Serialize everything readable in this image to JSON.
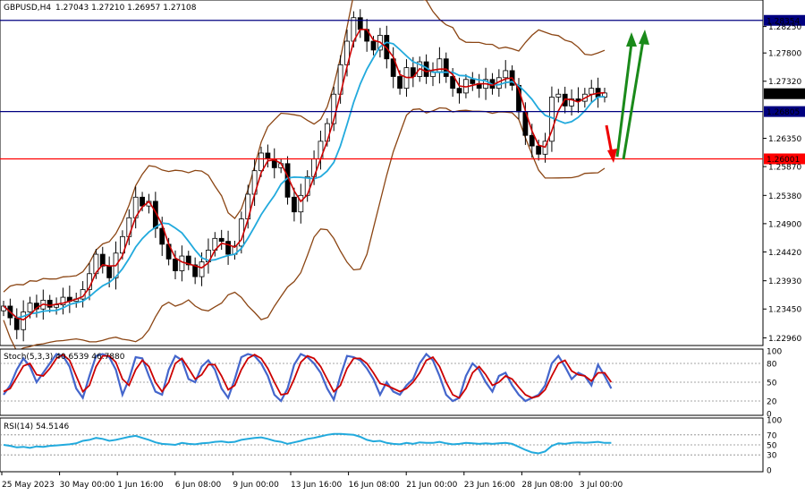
{
  "chart_data": {
    "type": "candlestick",
    "symbol_info": "GBPUSD,H4",
    "ohlc_info": "1.27043 1.27210 1.26957 1.27108",
    "price_ticks": [
      "1.28250",
      "1.27800",
      "1.27320",
      "1.26350",
      "1.25870",
      "1.25380",
      "1.24900",
      "1.24420",
      "1.23930",
      "1.23450",
      "1.22960"
    ],
    "price_range": [
      1.2283,
      1.287
    ],
    "x_labels": [
      "25 May 2023",
      "30 May 00:00",
      "1 Jun 16:00",
      "6 Jun 08:00",
      "9 Jun 00:00",
      "13 Jun 16:00",
      "16 Jun 08:00",
      "21 Jun 00:00",
      "23 Jun 16:00",
      "28 Jun 08:00",
      "3 Jul 00:00"
    ],
    "levels": [
      {
        "price": 1.28354,
        "label": "1.28354",
        "color": "#000080"
      },
      {
        "price": 1.26805,
        "label": "1.26805",
        "color": "#000080"
      },
      {
        "price": 1.26001,
        "label": "1.26001",
        "color": "#ff0000"
      }
    ],
    "current_price": {
      "price": 1.27108,
      "label": "1.27108"
    },
    "closes": [
      1.235,
      1.233,
      1.231,
      1.234,
      1.2355,
      1.2345,
      1.236,
      1.2348,
      1.2352,
      1.2365,
      1.2358,
      1.2362,
      1.2378,
      1.2405,
      1.2438,
      1.2418,
      1.2398,
      1.244,
      1.2468,
      1.25,
      1.2535,
      1.252,
      1.2528,
      1.2482,
      1.2455,
      1.243,
      1.241,
      1.2435,
      1.242,
      1.24,
      1.2425,
      1.2445,
      1.2465,
      1.246,
      1.2438,
      1.2452,
      1.2498,
      1.254,
      1.258,
      1.261,
      1.26,
      1.2585,
      1.2592,
      1.2535,
      1.251,
      1.2538,
      1.257,
      1.26,
      1.263,
      1.266,
      1.271,
      1.276,
      1.28,
      1.284,
      1.282,
      1.28,
      1.2785,
      1.281,
      1.277,
      1.274,
      1.272,
      1.2755,
      1.274,
      1.2765,
      1.274,
      1.2748,
      1.277,
      1.274,
      1.272,
      1.2712,
      1.2735,
      1.2728,
      1.272,
      1.2735,
      1.272,
      1.2738,
      1.275,
      1.2725,
      1.268,
      1.264,
      1.2622,
      1.2608,
      1.263,
      1.2705,
      1.271,
      1.269,
      1.2702,
      1.2698,
      1.271,
      1.272,
      1.2705,
      1.2712
    ],
    "stoch": {
      "label": "Stoch(5,3,3) 40.6539 46.7880",
      "ticks": [
        "100",
        "80",
        "50",
        "20",
        "0"
      ],
      "levels": [
        20,
        50,
        80
      ],
      "k": [
        30,
        45,
        70,
        88,
        75,
        50,
        65,
        80,
        95,
        92,
        75,
        40,
        25,
        60,
        92,
        95,
        90,
        70,
        30,
        55,
        90,
        88,
        60,
        35,
        30,
        70,
        92,
        85,
        55,
        50,
        75,
        85,
        70,
        40,
        25,
        55,
        90,
        95,
        92,
        80,
        60,
        30,
        20,
        40,
        78,
        95,
        90,
        80,
        65,
        40,
        22,
        60,
        92,
        90,
        85,
        72,
        55,
        30,
        50,
        35,
        30,
        45,
        55,
        80,
        95,
        85,
        60,
        30,
        20,
        25,
        60,
        80,
        70,
        50,
        35,
        60,
        65,
        45,
        30,
        20,
        25,
        30,
        45,
        80,
        92,
        75,
        55,
        65,
        60,
        45,
        78,
        60,
        40
      ],
      "d": [
        35,
        40,
        58,
        76,
        80,
        62,
        60,
        72,
        88,
        94,
        85,
        60,
        35,
        45,
        75,
        92,
        92,
        82,
        55,
        45,
        70,
        85,
        75,
        50,
        35,
        50,
        80,
        88,
        72,
        55,
        62,
        78,
        78,
        60,
        38,
        45,
        70,
        88,
        94,
        88,
        72,
        50,
        30,
        32,
        55,
        82,
        92,
        88,
        75,
        55,
        35,
        45,
        72,
        88,
        88,
        80,
        65,
        48,
        45,
        40,
        35,
        40,
        50,
        65,
        85,
        90,
        75,
        50,
        30,
        25,
        40,
        65,
        75,
        62,
        45,
        50,
        60,
        55,
        42,
        30,
        25,
        28,
        38,
        60,
        80,
        85,
        68,
        62,
        60,
        52,
        65,
        65,
        50
      ]
    },
    "rsi": {
      "label": "RSI(14) 54.5146",
      "ticks": [
        "100",
        "70",
        "50",
        "30",
        "0"
      ],
      "levels": [
        30,
        50,
        70
      ],
      "values": [
        50,
        48,
        45,
        46,
        44,
        47,
        46,
        48,
        49,
        50,
        51,
        53,
        58,
        60,
        64,
        62,
        58,
        60,
        63,
        66,
        68,
        64,
        60,
        55,
        52,
        51,
        50,
        54,
        52,
        51,
        53,
        54,
        56,
        57,
        55,
        56,
        60,
        62,
        64,
        65,
        62,
        58,
        56,
        52,
        55,
        58,
        62,
        64,
        67,
        70,
        72,
        72,
        71,
        70,
        66,
        60,
        57,
        58,
        54,
        52,
        51,
        54,
        52,
        55,
        54,
        54,
        56,
        53,
        51,
        52,
        54,
        53,
        52,
        53,
        52,
        53,
        54,
        52,
        46,
        40,
        35,
        33,
        37,
        48,
        53,
        52,
        54,
        55,
        54,
        55,
        56,
        54,
        54
      ]
    }
  }
}
